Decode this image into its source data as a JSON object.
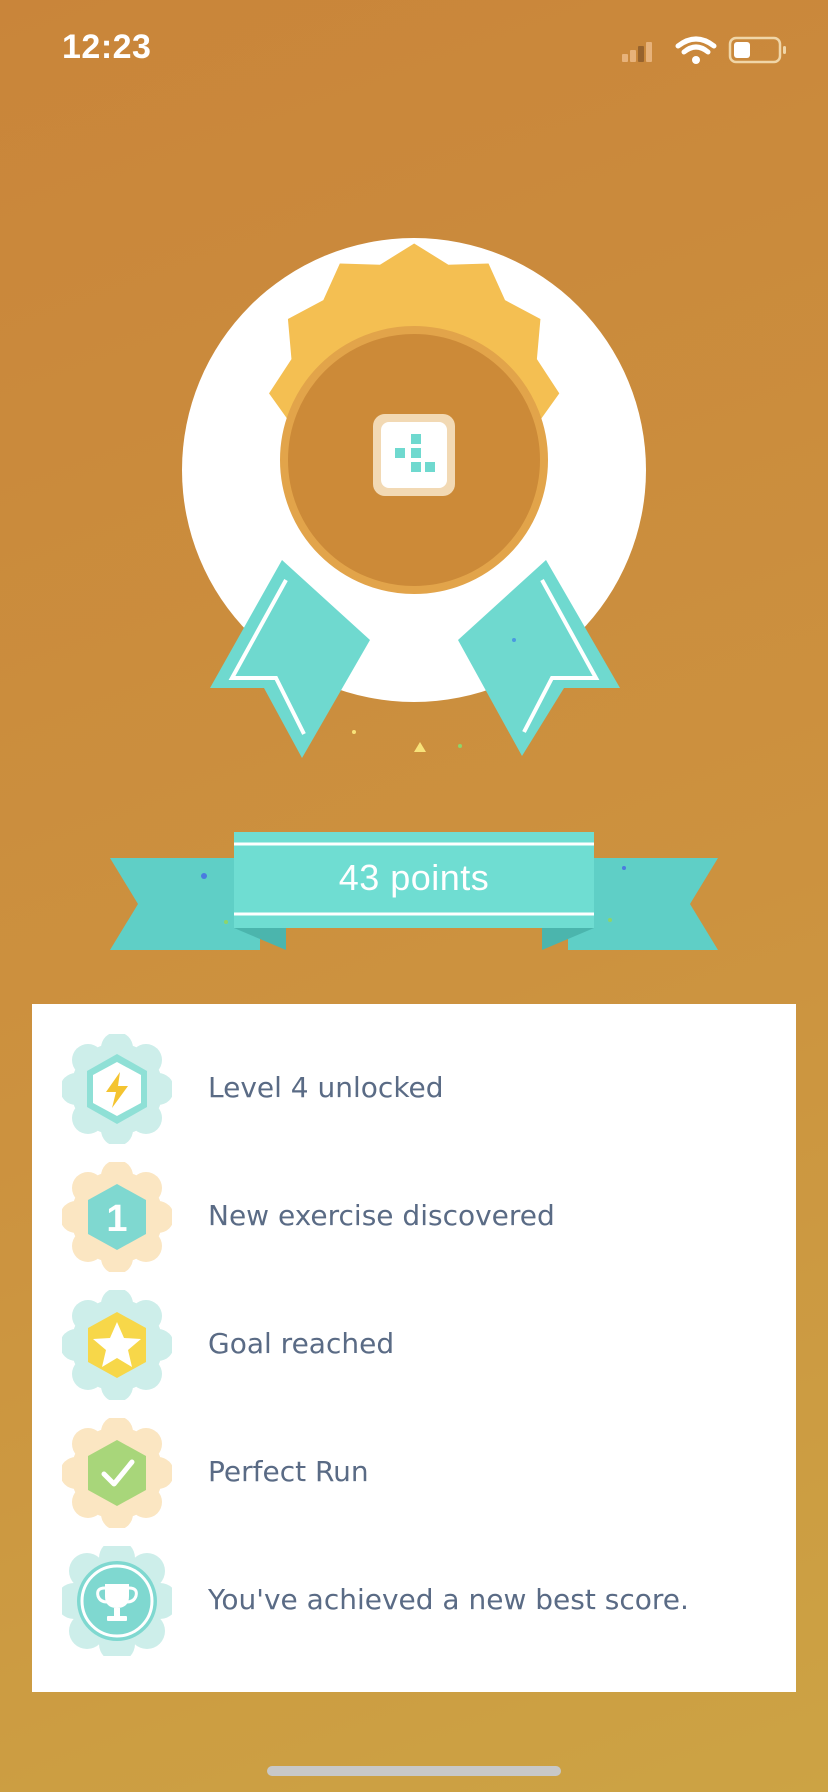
{
  "status_bar": {
    "time": "12:23"
  },
  "colors": {
    "background": "#c9853a",
    "medal_gold": "#f4bf52",
    "medal_center": "#cc8a38",
    "ribbon_teal": "#6fd9cf",
    "text_gray_blue": "#5a6b85"
  },
  "medal": {
    "icon": "grid-blocks-icon"
  },
  "banner": {
    "points_label": "43 points"
  },
  "achievements": [
    {
      "label": "Level 4 unlocked",
      "icon": "lightning-icon"
    },
    {
      "label": "New exercise discovered",
      "icon": "number-one-icon",
      "badge_text": "1"
    },
    {
      "label": "Goal reached",
      "icon": "star-icon"
    },
    {
      "label": "Perfect Run",
      "icon": "checkmark-icon"
    },
    {
      "label": "You've achieved a new best score.",
      "icon": "trophy-icon"
    }
  ]
}
